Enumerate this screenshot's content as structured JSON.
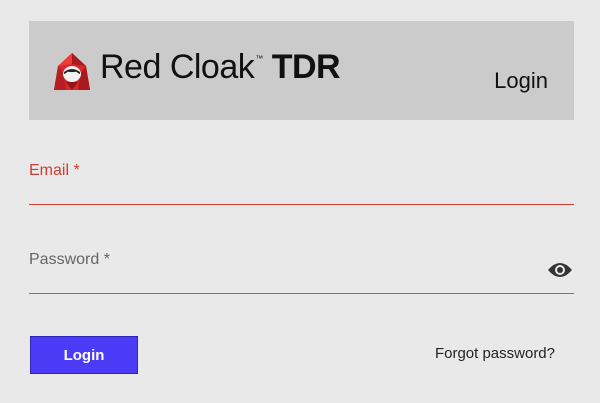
{
  "header": {
    "brand_name": "Red Cloak",
    "brand_tm": "™",
    "brand_suffix": "TDR",
    "title": "Login"
  },
  "form": {
    "email_label": "Email *",
    "password_label": "Password *",
    "login_button": "Login",
    "forgot_password": "Forgot password?"
  },
  "colors": {
    "accent": "#4a3cf7",
    "error": "#d23b2f",
    "brand_red": "#d8262a"
  }
}
